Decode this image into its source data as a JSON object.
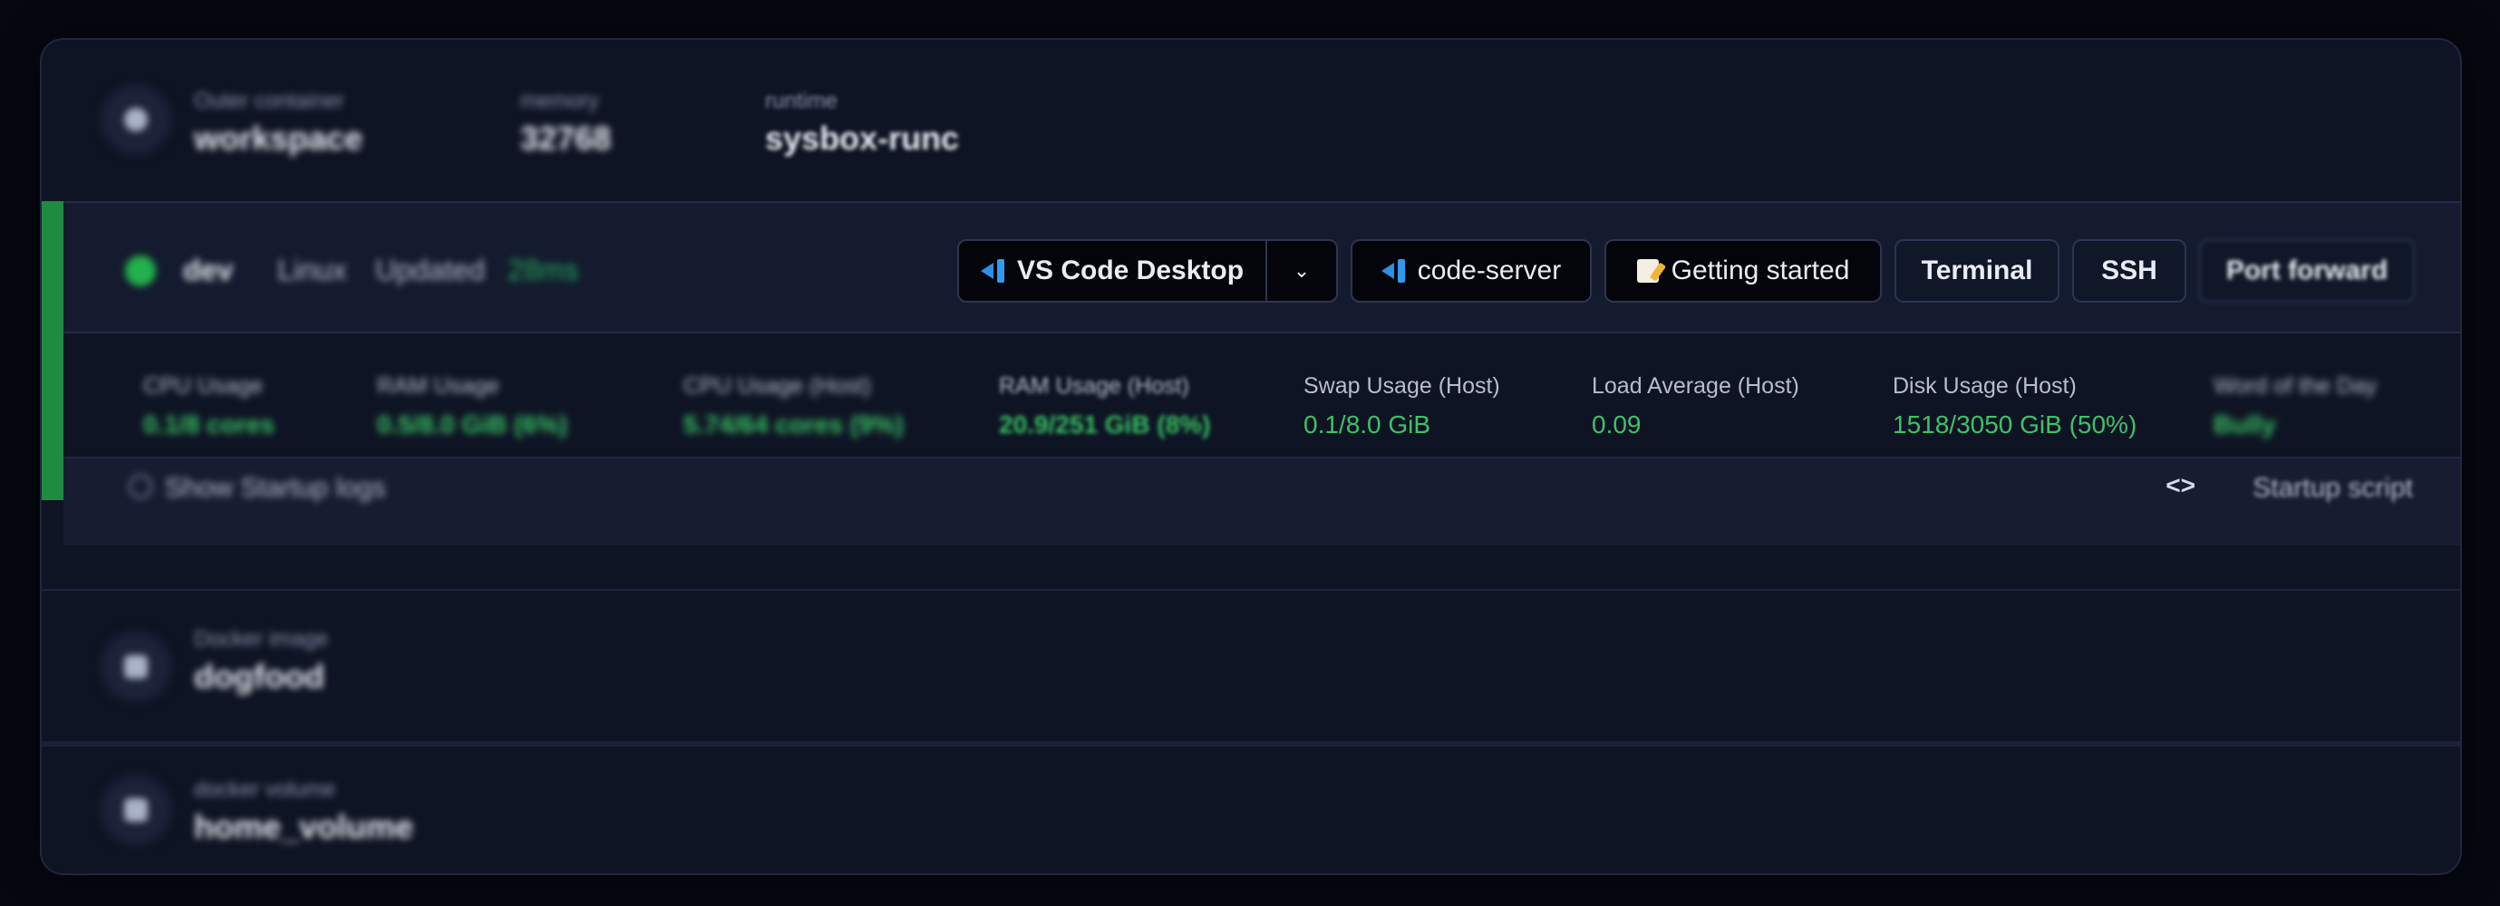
{
  "workspace": {
    "container": {
      "label": "Outer container",
      "value": "workspace"
    },
    "memory": {
      "label": "memory",
      "value": "32768"
    },
    "runtime": {
      "label": "runtime",
      "value": "sysbox-runc"
    }
  },
  "agent": {
    "name": "dev",
    "os": "Linux",
    "status": "Updated",
    "latency": "28ms",
    "buttons": {
      "vscode_desktop": "VS Code Desktop",
      "code_server": "code-server",
      "getting_started": "Getting started",
      "terminal": "Terminal",
      "ssh": "SSH",
      "port_forward": "Port forward"
    },
    "metrics": [
      {
        "label": "CPU Usage",
        "value": "0.1/8 cores"
      },
      {
        "label": "RAM Usage",
        "value": "0.5/8.0 GiB (6%)"
      },
      {
        "label": "CPU Usage (Host)",
        "value": "5.74/64 cores (9%)"
      },
      {
        "label": "RAM Usage (Host)",
        "value": "20.9/251 GiB (8%)"
      },
      {
        "label": "Swap Usage (Host)",
        "value": "0.1/8.0 GiB"
      },
      {
        "label": "Load Average (Host)",
        "value": "0.09"
      },
      {
        "label": "Disk Usage (Host)",
        "value": "1518/3050 GiB (50%)"
      },
      {
        "label": "Word of the Day",
        "value": "Bully"
      }
    ],
    "logs": {
      "show_label": "Show Startup logs",
      "script_label": "Startup script",
      "code_glyph": "<>"
    }
  },
  "resources": [
    {
      "label": "Docker image",
      "value": "dogfood"
    },
    {
      "label": "docker volume",
      "value": "home_volume"
    }
  ],
  "colors": {
    "accent_green": "#22b14c",
    "metric_green": "#3ec266",
    "vscode_blue": "#2f9bf0"
  },
  "icons": [
    "container-icon",
    "chevron-down-icon",
    "vscode-icon",
    "memo-icon",
    "code-brackets-icon",
    "status-dot-icon"
  ]
}
